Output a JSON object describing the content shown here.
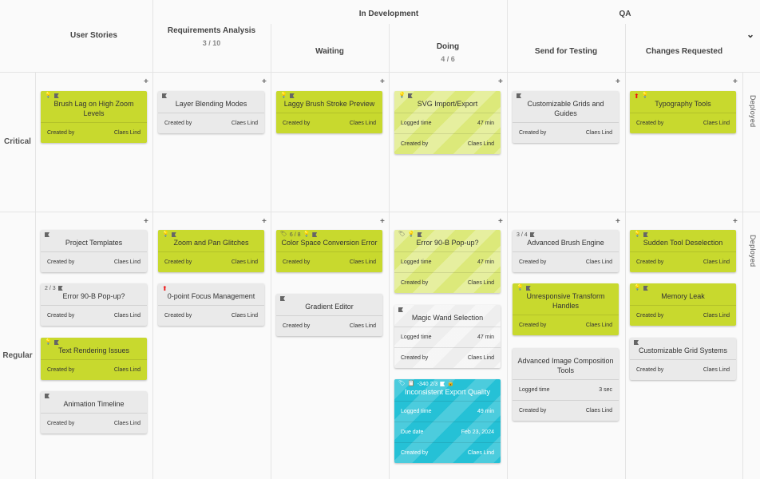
{
  "header": {
    "user_stories": "User Stories",
    "requirements": "Requirements Analysis",
    "requirements_count": "3 / 10",
    "in_development": "In Development",
    "qa": "QA",
    "waiting": "Waiting",
    "doing": "Doing",
    "doing_count": "4 / 6",
    "send_for_testing": "Send for Testing",
    "changes_requested": "Changes Requested"
  },
  "lanes": {
    "critical": "Critical",
    "regular": "Regular"
  },
  "deployed": {
    "critical": "Deployed",
    "regular": "Deployed"
  },
  "plus": "+",
  "chevron": "⌄",
  "labels": {
    "created_by": "Created by",
    "logged_time": "Logged time",
    "due_date": "Due date",
    "user": "Claes Lind"
  },
  "cards": {
    "c1": {
      "title": "Brush Lag on High Zoom Levels"
    },
    "c2": {
      "title": "Layer Blending Modes"
    },
    "c3": {
      "title": "Laggy Brush Stroke Preview"
    },
    "c4": {
      "title": "SVG Import/Export",
      "logged": "47 min"
    },
    "c5": {
      "title": "Customizable Grids and Guides"
    },
    "c6": {
      "title": "Typography Tools"
    },
    "r1": {
      "title": "Project Templates"
    },
    "r2": {
      "title": "Error 90-B Pop-up?",
      "meta": "2 / 3"
    },
    "r3": {
      "title": "Text Rendering Issues"
    },
    "r4": {
      "title": "Animation Timeline"
    },
    "r5": {
      "title": "Zoom and Pan Glitches"
    },
    "r6": {
      "title": "0-point Focus Management"
    },
    "r7": {
      "title": "Color Space Conversion Error",
      "meta": "6 / 8"
    },
    "r8": {
      "title": "Gradient Editor"
    },
    "r9": {
      "title": "Error 90-B Pop-up?",
      "logged": "47 min"
    },
    "r10": {
      "title": "Magic Wand Selection",
      "logged": "47 min"
    },
    "r11": {
      "title": "Inconsistent Export Quality",
      "meta": "-340  2/3",
      "logged": "49 min",
      "due": "Feb 23, 2024"
    },
    "r12": {
      "title": "Advanced Brush Engine",
      "meta": "3 / 4"
    },
    "r13": {
      "title": "Unresponsive Transform Handles"
    },
    "r14": {
      "title": "Advanced Image Composition Tools",
      "logged": "3 sec"
    },
    "r15": {
      "title": "Sudden Tool Deselection"
    },
    "r16": {
      "title": "Memory Leak"
    },
    "r17": {
      "title": "Customizable Grid Systems"
    }
  }
}
